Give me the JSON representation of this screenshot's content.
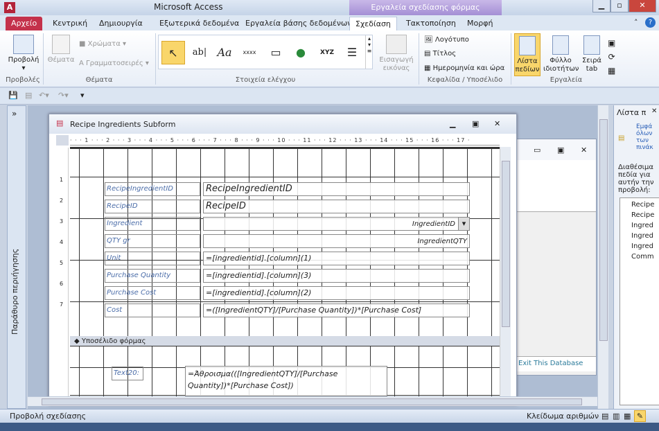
{
  "window": {
    "title": "Microsoft Access",
    "context_tab": "Εργαλεία σχεδίασης φόρμας",
    "app_icon": "A"
  },
  "tabs": [
    "Αρχείο",
    "Κεντρική",
    "Δημιουργία",
    "Εξωτερικά δεδομένα",
    "Εργαλεία βάσης δεδομένων",
    "Σχεδίαση",
    "Τακτοποίηση",
    "Μορφή"
  ],
  "active_tab": "Σχεδίαση",
  "ribbon": {
    "views": {
      "view": "Προβολή",
      "label": "Προβολές"
    },
    "themes": {
      "themes": "Θέματα",
      "colors": "Χρώματα",
      "fonts": "Γραμματοσειρές",
      "label": "Θέματα"
    },
    "controls": {
      "label": "Στοιχεία ελέγχου",
      "items": [
        "select-pointer",
        "textbox",
        "label",
        "button",
        "tab-control",
        "hyperlink",
        "option-group",
        "list-box"
      ],
      "textbox_glyph": "ab|",
      "label_glyph": "Aa",
      "button_glyph": "xxxx",
      "option_glyph": "XYZ"
    },
    "insert_image": {
      "line1": "Εισαγωγή",
      "line2": "εικόνας"
    },
    "header_footer": {
      "logo": "Λογότυπο",
      "title": "Τίτλος",
      "datetime": "Ημερομηνία και ώρα",
      "label": "Κεφαλίδα / Υποσέλιδο"
    },
    "tools": {
      "field_list_1": "Λίστα",
      "field_list_2": "πεδίων",
      "property_sheet_1": "Φύλλο",
      "property_sheet_2": "ιδιοτήτων",
      "tab_order_1": "Σειρά",
      "tab_order_2": "tab",
      "label": "Εργαλεία"
    }
  },
  "nav_pane": {
    "label": "Παράθυρο περιήγησης",
    "toggle": "»"
  },
  "form": {
    "title": "Recipe Ingredients Subform",
    "ruler": "· · · 1 · · · 2 · · · 3 · · · 4 · · · 5 · · · 6 · · · 7 · · · 8 · · · 9 · · · 10 · · · 11 · · · 12 · · · 13 · · · 14 · · · 15 · · · 16 · · · 17 ·",
    "vruler_ticks": [
      "1",
      "2",
      "3",
      "4",
      "5",
      "6",
      "7"
    ],
    "rows": [
      {
        "label": "RecipeIngredientID",
        "value": "RecipeIngredientID",
        "align": "left"
      },
      {
        "label": "RecipeID",
        "value": "RecipeID",
        "align": "left"
      },
      {
        "label": "Ingredient",
        "value": "IngredientID",
        "align": "right",
        "combo": true
      },
      {
        "label": "QTY gr",
        "value": "IngredientQTY",
        "align": "right"
      },
      {
        "label": "Unit",
        "value": "=[ingredientid].[column](1)",
        "align": "left"
      },
      {
        "label": "Purchase Quantity",
        "value": "=[ingredientid].[column](3)",
        "align": "left"
      },
      {
        "label": "Purchase Cost",
        "value": "=[ingredientid].[column](2)",
        "align": "left"
      },
      {
        "label": "Cost",
        "value": "=([IngredientQTY]/[Purchase Quantity])*[Purchase Cost]",
        "align": "left"
      }
    ],
    "footer_section": "Υποσέλιδο φόρμας",
    "footer_label": "Text20:",
    "footer_value_1": "=Άθροισμα(([IngredientQTY]/[Purchase",
    "footer_value_2": "Quantity])*[Purchase Cost])"
  },
  "background_window": {
    "link": "Exit This Database"
  },
  "field_list": {
    "title": "Λίστα π",
    "show_all": "Εμφά όλων των πινάκ",
    "available": "Διαθέσιμα πεδία για αυτήν την προβολή:",
    "fields": [
      "Recipe",
      "Recipe",
      "Ingred",
      "Ingred",
      "Ingred",
      "Comm"
    ]
  },
  "status": {
    "left": "Προβολή σχεδίασης",
    "num_lock": "Κλείδωμα αριθμών"
  },
  "colors": {
    "file_tab": "#c4314b",
    "context": "#a48fd5",
    "label_text": "#4a6ca8",
    "highlight": "#f9d66b"
  }
}
